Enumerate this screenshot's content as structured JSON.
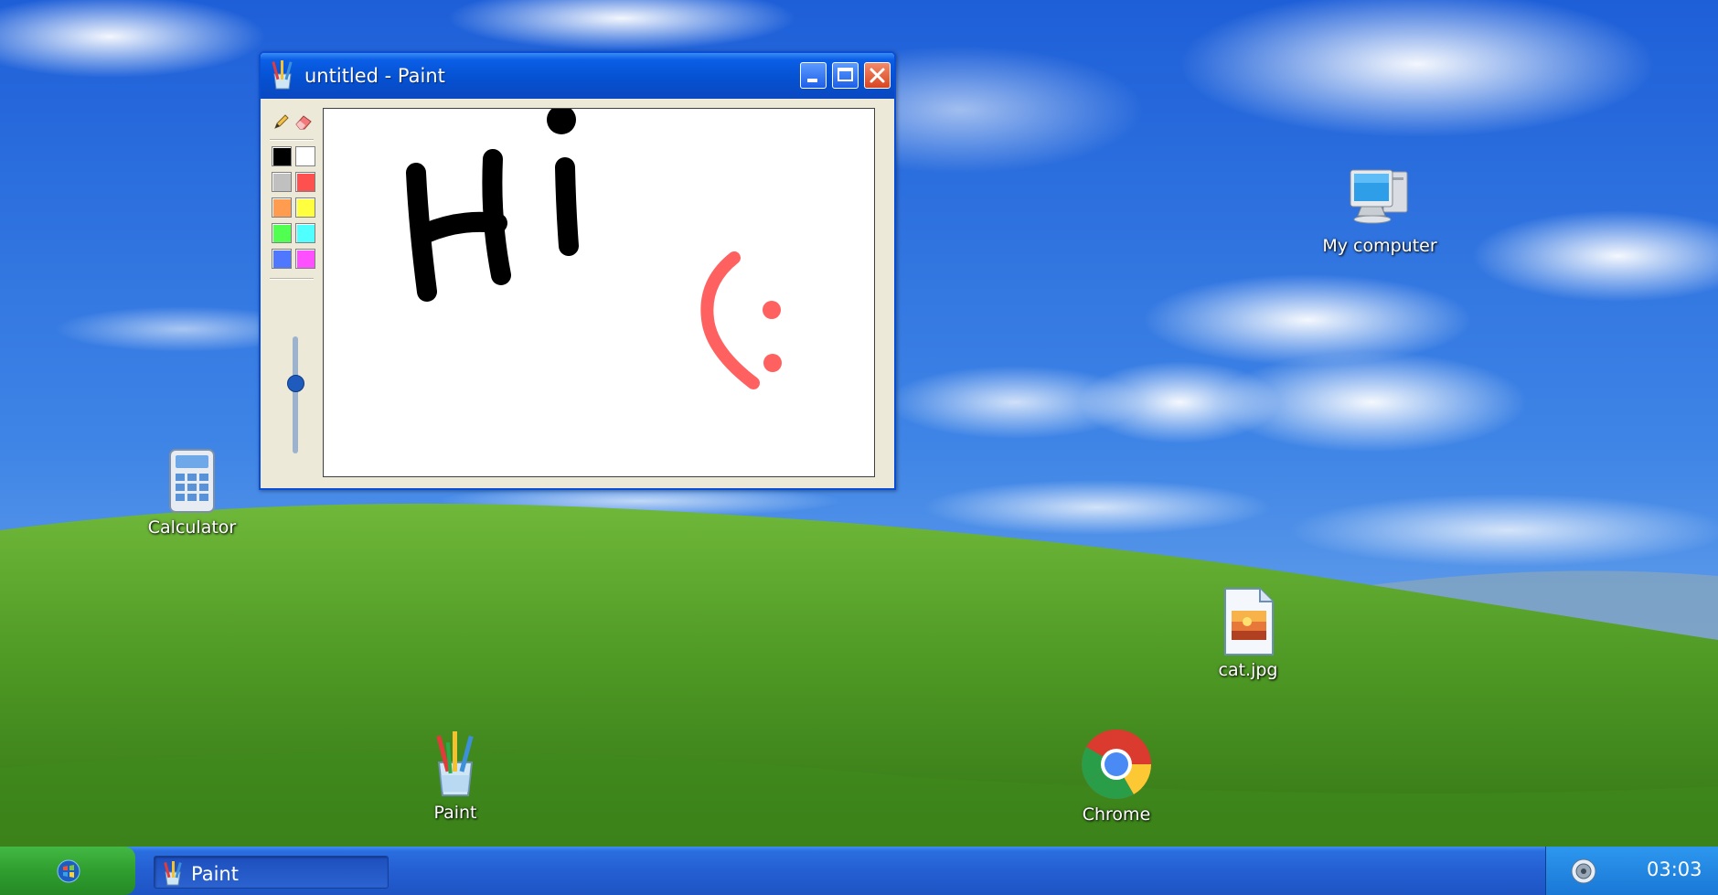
{
  "desktop": {
    "icons": [
      {
        "label": "My computer",
        "icon": "monitor-computer-icon"
      },
      {
        "label": "Calculator",
        "icon": "calculator-icon"
      },
      {
        "label": "cat.jpg",
        "icon": "image-file-icon"
      },
      {
        "label": "Paint",
        "icon": "paint-brushes-icon"
      },
      {
        "label": "Chrome",
        "icon": "chrome-icon"
      }
    ]
  },
  "paint_window": {
    "title": "untitled - Paint",
    "tools": [
      "pencil-icon",
      "eraser-icon"
    ],
    "palette": [
      "#000000",
      "#ffffff",
      "#c0c0c0",
      "#ff5050",
      "#ff9c50",
      "#ffff40",
      "#50ff50",
      "#50ffff",
      "#5078ff",
      "#ff50ff"
    ],
    "brush_size_level": 0.4,
    "colors": {
      "drawing_black": "#000000",
      "drawing_red": "#ff6161"
    }
  },
  "taskbar": {
    "start_icon": "windows-logo-icon",
    "tasks": [
      {
        "label": "Paint",
        "icon": "paint-brushes-icon"
      }
    ],
    "tray_icon": "speaker-icon",
    "clock": "03:03"
  },
  "colors": {
    "taskbar_blue": "#245fd2",
    "start_green": "#2f9e2f",
    "titlebar_blue": "#0550d0"
  }
}
